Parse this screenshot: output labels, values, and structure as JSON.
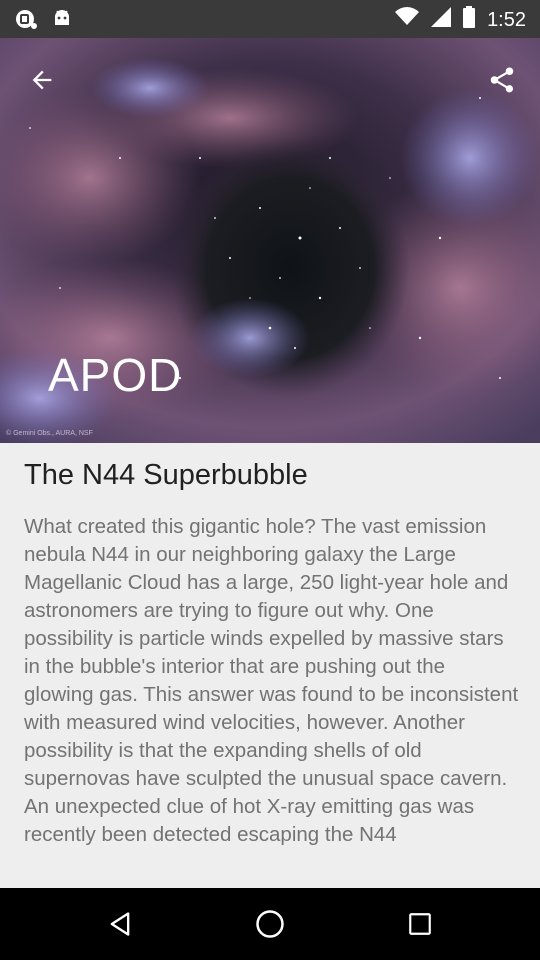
{
  "status_bar": {
    "time": "1:52",
    "icons": [
      "notification-icon",
      "android-icon",
      "wifi-icon",
      "signal-icon",
      "battery-icon"
    ]
  },
  "header": {
    "app_title": "APOD",
    "image_credit": "© Gemini Obs., AURA, NSF",
    "back_icon": "arrow-back-icon",
    "share_icon": "share-icon"
  },
  "article": {
    "title": "The N44 Superbubble",
    "body": "What created this gigantic hole?  The vast emission nebula N44 in our neighboring galaxy the Large Magellanic Cloud has a large, 250 light-year hole and astronomers are trying to figure out why.  One possibility is particle winds expelled by massive stars in the bubble's interior that are pushing out the glowing gas.  This answer was found to be inconsistent with measured wind velocities, however.  Another possibility is that the expanding shells of old supernovas have sculpted the unusual space cavern.   An unexpected clue of hot X-ray emitting gas was recently been detected escaping the N44"
  },
  "nav_bar": {
    "icons": [
      "nav-back-icon",
      "nav-home-icon",
      "nav-recents-icon"
    ]
  }
}
